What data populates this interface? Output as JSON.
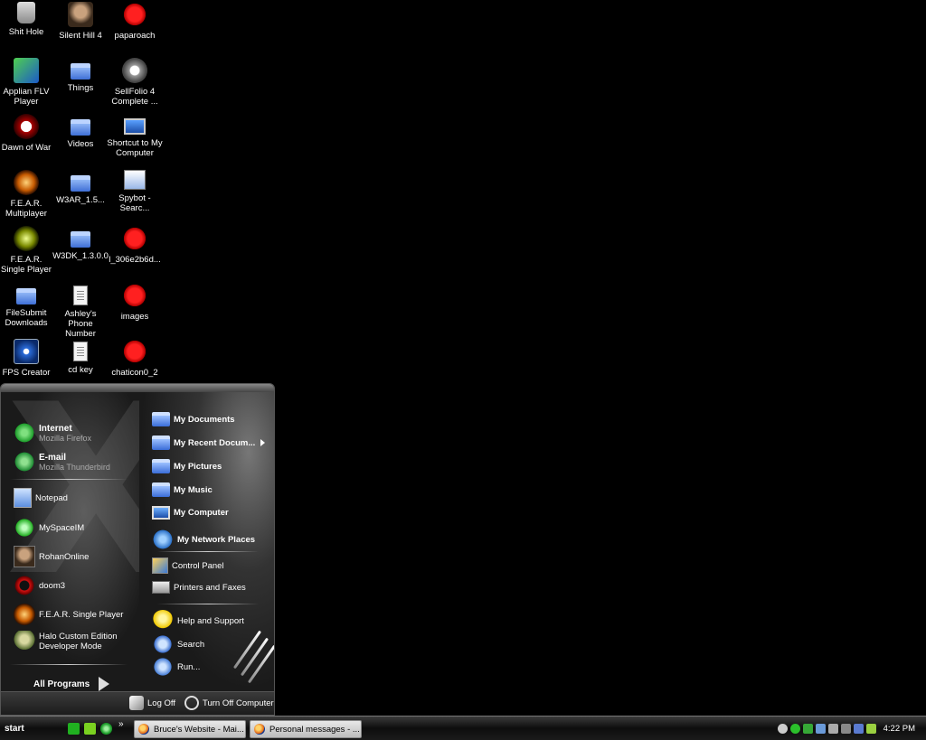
{
  "desktop": {
    "icons": [
      {
        "label": "Shit Hole",
        "icon": "recycle-bin-icon"
      },
      {
        "label": "Silent Hill 4",
        "icon": "silent-hill-icon"
      },
      {
        "label": "paparoach",
        "icon": "red-splat-icon"
      },
      {
        "label": "Applian FLV Player",
        "icon": "flv-player-icon"
      },
      {
        "label": "Things",
        "icon": "folder-icon"
      },
      {
        "label": "SellFolio 4 Complete ...",
        "icon": "sellfolio-icon"
      },
      {
        "label": "Dawn of War",
        "icon": "skull-icon"
      },
      {
        "label": "Videos",
        "icon": "folder-icon"
      },
      {
        "label": "Shortcut to My Computer",
        "icon": "my-computer-icon"
      },
      {
        "label": "F.E.A.R. Multiplayer",
        "icon": "fear-icon"
      },
      {
        "label": "W3AR_1.5...",
        "icon": "folder-icon"
      },
      {
        "label": "Spybot - Searc...",
        "icon": "spybot-icon"
      },
      {
        "label": "F.E.A.R. Single Player",
        "icon": "fear-icon"
      },
      {
        "label": "W3DK_1.3.0.0",
        "icon": "folder-icon"
      },
      {
        "label": "l_306e2b6d...",
        "icon": "red-splat-icon"
      },
      {
        "label": "FileSubmit Downloads",
        "icon": "folder-icon"
      },
      {
        "label": "Ashley's Phone Number",
        "icon": "text-document-icon"
      },
      {
        "label": "images",
        "icon": "red-splat-icon"
      },
      {
        "label": "FPS Creator",
        "icon": "fps-creator-icon"
      },
      {
        "label": "cd key",
        "icon": "text-document-icon"
      },
      {
        "label": "chaticon0_2",
        "icon": "red-splat-icon"
      }
    ]
  },
  "start_menu": {
    "pinned": [
      {
        "title": "Internet",
        "subtitle": "Mozilla Firefox"
      },
      {
        "title": "E-mail",
        "subtitle": "Mozilla Thunderbird"
      }
    ],
    "recent": [
      {
        "label": "Notepad"
      },
      {
        "label": "MySpaceIM"
      },
      {
        "label": "RohanOnline"
      },
      {
        "label": "doom3"
      },
      {
        "label": "F.E.A.R. Single Player"
      },
      {
        "label": "Halo Custom Edition Developer Mode"
      }
    ],
    "all_programs": "All Programs",
    "places": [
      {
        "label": "My Documents"
      },
      {
        "label": "My Recent Docum..."
      },
      {
        "label": "My Pictures"
      },
      {
        "label": "My Music"
      },
      {
        "label": "My Computer"
      },
      {
        "label": "My Network Places"
      }
    ],
    "system": [
      {
        "label": "Control Panel"
      },
      {
        "label": "Printers and Faxes"
      }
    ],
    "help": [
      {
        "label": "Help and Support"
      },
      {
        "label": "Search"
      },
      {
        "label": "Run..."
      }
    ],
    "log_off": "Log Off",
    "turn_off": "Turn Off Computer"
  },
  "taskbar": {
    "start_label": "start",
    "quicklaunch_more": "»",
    "tasks": [
      {
        "label": "Bruce's Website - Mai..."
      },
      {
        "label": "Personal messages - ..."
      }
    ],
    "clock": "4:22 PM"
  }
}
